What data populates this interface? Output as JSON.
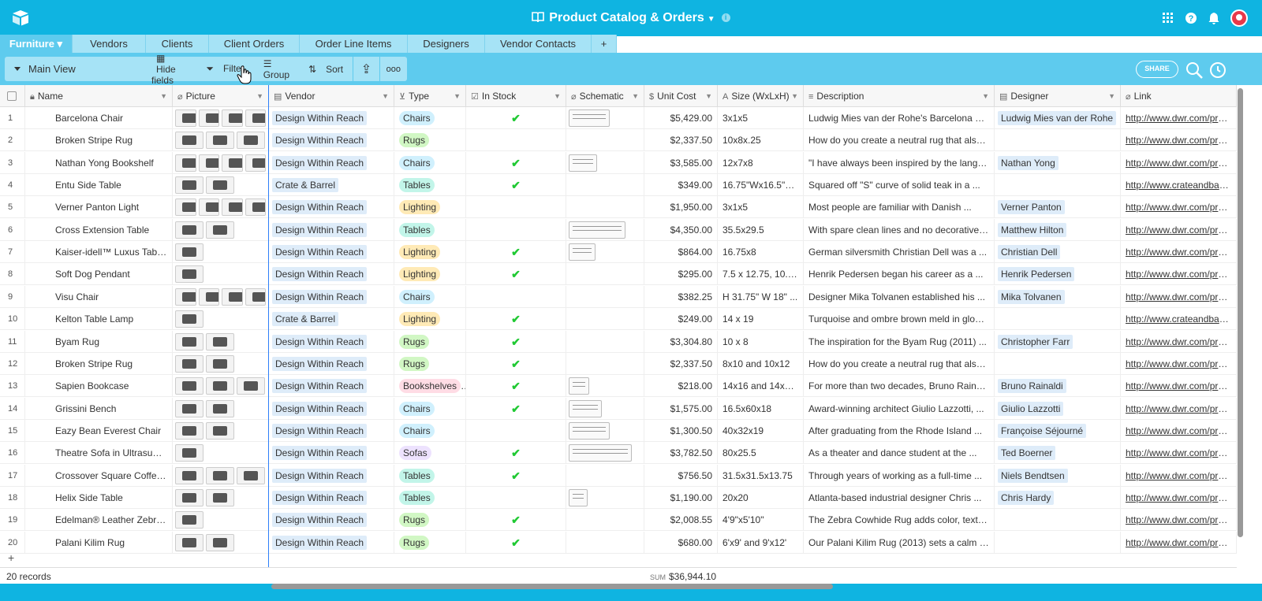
{
  "app": {
    "base_title": "Product Catalog & Orders",
    "colors": {
      "primary": "#0fb4e1",
      "secondary": "#5ecbee"
    }
  },
  "tabs": [
    {
      "label": "Furniture ▾",
      "active": true
    },
    {
      "label": "Vendors"
    },
    {
      "label": "Clients"
    },
    {
      "label": "Client Orders"
    },
    {
      "label": "Order Line Items"
    },
    {
      "label": "Designers"
    },
    {
      "label": "Vendor Contacts"
    },
    {
      "label": "+"
    }
  ],
  "toolbar": {
    "view_name": "Main View",
    "hide_fields": "Hide fields",
    "filter": "Filter",
    "group": "Group",
    "sort": "Sort",
    "more": "ooo",
    "share": "SHARE"
  },
  "columns": [
    {
      "label": "Name",
      "icon": "lock-icon"
    },
    {
      "label": "Picture",
      "icon": "paperclip-icon"
    },
    {
      "label": "Vendor",
      "icon": "link-record-icon"
    },
    {
      "label": "Type",
      "icon": "single-select-icon"
    },
    {
      "label": "In Stock",
      "icon": "checkbox-icon"
    },
    {
      "label": "Schematic",
      "icon": "paperclip-icon"
    },
    {
      "label": "Unit Cost",
      "icon": "currency-icon"
    },
    {
      "label": "Size (WxLxH)",
      "icon": "text-icon"
    },
    {
      "label": "Description",
      "icon": "long-text-icon"
    },
    {
      "label": "Designer",
      "icon": "link-record-icon"
    },
    {
      "label": "Link",
      "icon": "url-icon"
    }
  ],
  "type_colors": {
    "Chairs": "#d0f0fd",
    "Rugs": "#d1f7c4",
    "Tables": "#c2f5e9",
    "Lighting": "#ffeab6",
    "Bookshelves": "#ffdce5",
    "Sofas": "#ede2fe"
  },
  "rows": [
    {
      "n": "1",
      "name": "Barcelona Chair",
      "pics": 4,
      "vendor": "Design Within Reach",
      "type": "Chairs",
      "stock": true,
      "sch": 52,
      "cost": "$5,429.00",
      "size": "3x1x5",
      "desc": "Ludwig Mies van der Rohe's Barcelona Chai...",
      "designer": "Ludwig Mies van der Rohe",
      "link": "http://www.dwr.com/prod..."
    },
    {
      "n": "2",
      "name": "Broken Stripe Rug",
      "pics": 3,
      "vendor": "Design Within Reach",
      "type": "Rugs",
      "stock": false,
      "sch": 0,
      "cost": "$2,337.50",
      "size": "10x8x.25",
      "desc": "How do you create a neutral rug that also ...",
      "designer": "",
      "link": "http://www.dwr.com/prod..."
    },
    {
      "n": "3",
      "name": "Nathan Yong Bookshelf",
      "pics": 4,
      "vendor": "Design Within Reach",
      "type": "Chairs",
      "stock": true,
      "sch": 36,
      "cost": "$3,585.00",
      "size": "12x7x8",
      "desc": "\"I have always been inspired by the langua...",
      "designer": "Nathan Yong",
      "link": "http://www.dwr.com/prod..."
    },
    {
      "n": "4",
      "name": "Entu Side Table",
      "pics": 2,
      "vendor": "Crate & Barrel",
      "type": "Tables",
      "stock": true,
      "sch": 0,
      "cost": "$349.00",
      "size": "16.75\"Wx16.5\"Dx...",
      "desc": "Squared off \"S\" curve of solid teak in a ...",
      "designer": "",
      "link": "http://www.crateandbarrel..."
    },
    {
      "n": "5",
      "name": "Verner Panton Light",
      "pics": 4,
      "vendor": "Design Within Reach",
      "type": "Lighting",
      "stock": false,
      "sch": 0,
      "cost": "$1,950.00",
      "size": "3x1x5",
      "desc": "Most people are familiar with Danish ...",
      "designer": "Verner Panton",
      "link": "http://www.dwr.com/prod..."
    },
    {
      "n": "6",
      "name": "Cross Extension Table",
      "pics": 2,
      "vendor": "Design Within Reach",
      "type": "Tables",
      "stock": false,
      "sch": 72,
      "cost": "$4,350.00",
      "size": "35.5x29.5",
      "desc": "With spare clean lines and no decorative ...",
      "designer": "Matthew Hilton",
      "link": "http://www.dwr.com/prod..."
    },
    {
      "n": "7",
      "name": "Kaiser-idell™ Luxus Table L...",
      "pics": 1,
      "vendor": "Design Within Reach",
      "type": "Lighting",
      "stock": true,
      "sch": 34,
      "cost": "$864.00",
      "size": "16.75x8",
      "desc": "German silversmith Christian Dell was a ...",
      "designer": "Christian Dell",
      "link": "http://www.dwr.com/prod..."
    },
    {
      "n": "8",
      "name": "Soft Dog Pendant",
      "pics": 1,
      "vendor": "Design Within Reach",
      "type": "Lighting",
      "stock": true,
      "sch": 0,
      "cost": "$295.00",
      "size": "7.5 x 12.75, 10.5 ...",
      "desc": "Henrik Pedersen began his career as a ...",
      "designer": "Henrik Pedersen",
      "link": "http://www.dwr.com/prod..."
    },
    {
      "n": "9",
      "name": "Visu Chair",
      "pics": 4,
      "vendor": "Design Within Reach",
      "type": "Chairs",
      "stock": false,
      "sch": 0,
      "cost": "$382.25",
      "size": "H 31.75\" W 18\" ...",
      "desc": "Designer Mika Tolvanen established his ...",
      "designer": "Mika Tolvanen",
      "link": "http://www.dwr.com/prod..."
    },
    {
      "n": "10",
      "name": "Kelton Table Lamp",
      "pics": 1,
      "vendor": "Crate & Barrel",
      "type": "Lighting",
      "stock": true,
      "sch": 0,
      "cost": "$249.00",
      "size": "14 x 19",
      "desc": "Turquoise and ombre brown meld in glossy...",
      "designer": "",
      "link": "http://www.crateandbarrel..."
    },
    {
      "n": "11",
      "name": "Byam Rug",
      "pics": 2,
      "vendor": "Design Within Reach",
      "type": "Rugs",
      "stock": true,
      "sch": 0,
      "cost": "$3,304.80",
      "size": "10 x 8",
      "desc": "The inspiration for the Byam Rug (2011) ...",
      "designer": "Christopher Farr",
      "link": "http://www.dwr.com/prod..."
    },
    {
      "n": "12",
      "name": "Broken Stripe Rug",
      "pics": 2,
      "vendor": "Design Within Reach",
      "type": "Rugs",
      "stock": true,
      "sch": 0,
      "cost": "$2,337.50",
      "size": "8x10 and 10x12",
      "desc": "How do you create a neutral rug that also ...",
      "designer": "",
      "link": "http://www.dwr.com/prod..."
    },
    {
      "n": "13",
      "name": "Sapien Bookcase",
      "pics": 3,
      "vendor": "Design Within Reach",
      "type": "Bookshelves",
      "stock": true,
      "sch": 26,
      "cost": "$218.00",
      "size": "14x16 and 14x79.5",
      "desc": "For more than two decades, Bruno Rainaldi ...",
      "designer": "Bruno Rainaldi",
      "link": "http://www.dwr.com/prod..."
    },
    {
      "n": "14",
      "name": "Grissini Bench",
      "pics": 2,
      "vendor": "Design Within Reach",
      "type": "Chairs",
      "stock": true,
      "sch": 42,
      "cost": "$1,575.00",
      "size": "16.5x60x18",
      "desc": "Award-winning architect Giulio Lazzotti, ...",
      "designer": "Giulio Lazzotti",
      "link": "http://www.dwr.com/prod..."
    },
    {
      "n": "15",
      "name": "Eazy Bean Everest Chair",
      "pics": 2,
      "vendor": "Design Within Reach",
      "type": "Chairs",
      "stock": false,
      "sch": 52,
      "cost": "$1,300.50",
      "size": "40x32x19",
      "desc": "After graduating from the Rhode Island ...",
      "designer": "Françoise Séjourné",
      "link": "http://www.dwr.com/prod..."
    },
    {
      "n": "16",
      "name": "Theatre Sofa in Ultrasuede",
      "pics": 1,
      "vendor": "Design Within Reach",
      "type": "Sofas",
      "stock": true,
      "sch": 80,
      "cost": "$3,782.50",
      "size": "80x25.5",
      "desc": "As a theater and dance student at the ...",
      "designer": "Ted Boerner",
      "link": "http://www.dwr.com/prod..."
    },
    {
      "n": "17",
      "name": "Crossover Square Coffee T...",
      "pics": 3,
      "vendor": "Design Within Reach",
      "type": "Tables",
      "stock": true,
      "sch": 0,
      "cost": "$756.50",
      "size": "31.5x31.5x13.75",
      "desc": "Through years of working as a full-time ...",
      "designer": "Niels Bendtsen",
      "link": "http://www.dwr.com/prod..."
    },
    {
      "n": "18",
      "name": "Helix Side Table",
      "pics": 2,
      "vendor": "Design Within Reach",
      "type": "Tables",
      "stock": false,
      "sch": 24,
      "cost": "$1,190.00",
      "size": "20x20",
      "desc": "Atlanta-based industrial designer Chris ...",
      "designer": "Chris Hardy",
      "link": "http://www.dwr.com/prod..."
    },
    {
      "n": "19",
      "name": "Edelman® Leather Zebra ...",
      "pics": 1,
      "vendor": "Design Within Reach",
      "type": "Rugs",
      "stock": true,
      "sch": 0,
      "cost": "$2,008.55",
      "size": "4'9\"x5'10\"",
      "desc": "The Zebra Cowhide Rug adds color, texture ...",
      "designer": "",
      "link": "http://www.dwr.com/prod..."
    },
    {
      "n": "20",
      "name": "Palani Kilim Rug",
      "pics": 2,
      "vendor": "Design Within Reach",
      "type": "Rugs",
      "stock": true,
      "sch": 0,
      "cost": "$680.00",
      "size": "6'x9' and 9'x12'",
      "desc": "Our Palani Kilim Rug (2013) sets a calm mo...",
      "designer": "",
      "link": "http://www.dwr.com/prod..."
    }
  ],
  "footer": {
    "records": "20 records",
    "sum_label": "SUM",
    "sum_value": "$36,944.10"
  }
}
